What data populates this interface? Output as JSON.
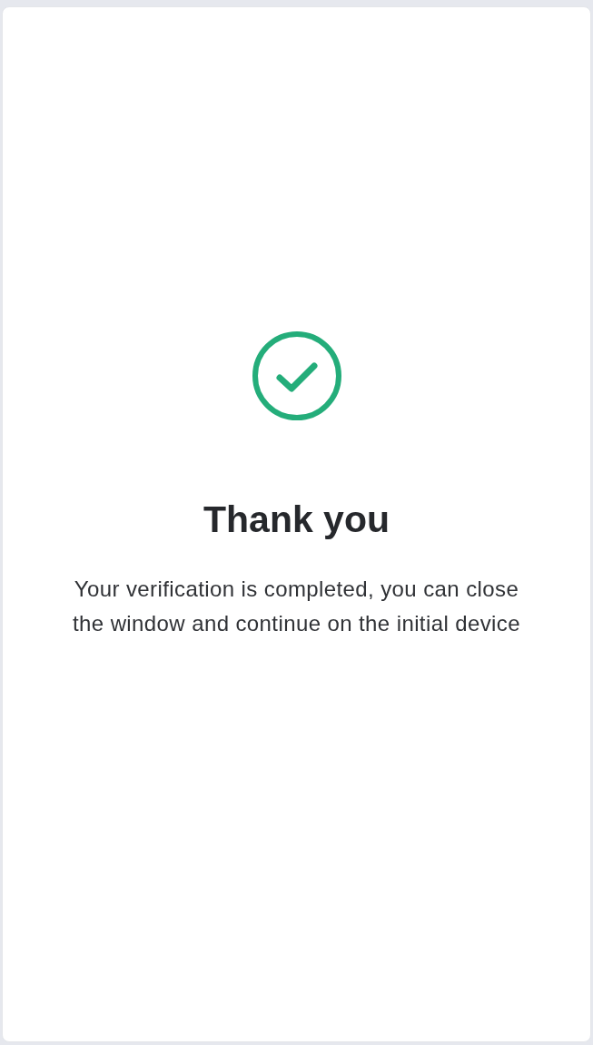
{
  "title": "Thank you",
  "message": "Your verification is completed, you can close the window and continue on the initial device"
}
